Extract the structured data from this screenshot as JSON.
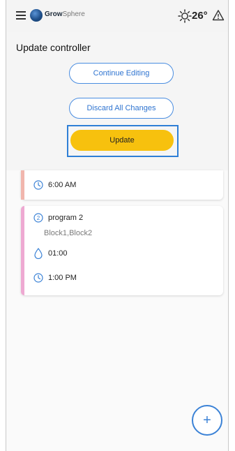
{
  "header": {
    "brand_strong": "Grow",
    "brand_light": "Sphere",
    "temperature": "26°",
    "icons": [
      "menu-icon",
      "logo-icon",
      "sun-icon",
      "warning-icon"
    ]
  },
  "dialog": {
    "title": "Update controller",
    "continue_label": "Continue Editing",
    "discard_label": "Discard All Changes",
    "update_label": "Update"
  },
  "programs": [
    {
      "start_time": "6:00 AM",
      "accent_color": "#f1b6ad"
    },
    {
      "number": "2",
      "name": "program 2",
      "blocks": "Block1,Block2",
      "duration": "01:00",
      "start_time": "1:00 PM",
      "accent_color": "#eea9d2"
    }
  ],
  "fab": {
    "label": "+"
  },
  "colors": {
    "accent_blue": "#3b82d6",
    "update_yellow": "#f7c10e"
  }
}
